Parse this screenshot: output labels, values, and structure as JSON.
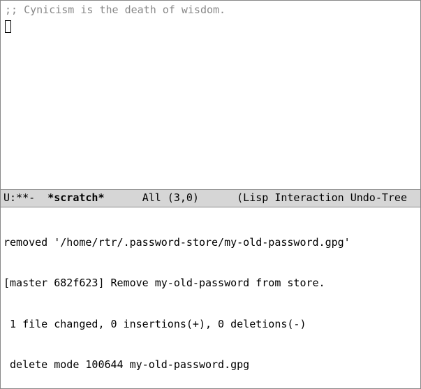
{
  "buffer": {
    "comment": ";; Cynicism is the death of wisdom."
  },
  "mode_line": {
    "status": "U:**-  ",
    "buffer_name": "*scratch*",
    "gap1": "      ",
    "position": "All (3,0)",
    "gap2": "      ",
    "modes": "(Lisp Interaction Undo-Tree"
  },
  "echo": {
    "l1": "removed '/home/rtr/.password-store/my-old-password.gpg'",
    "l2": "[master 682f623] Remove my-old-password from store.",
    "l3": " 1 file changed, 0 insertions(+), 0 deletions(-)",
    "l4": " delete mode 100644 my-old-password.gpg"
  }
}
